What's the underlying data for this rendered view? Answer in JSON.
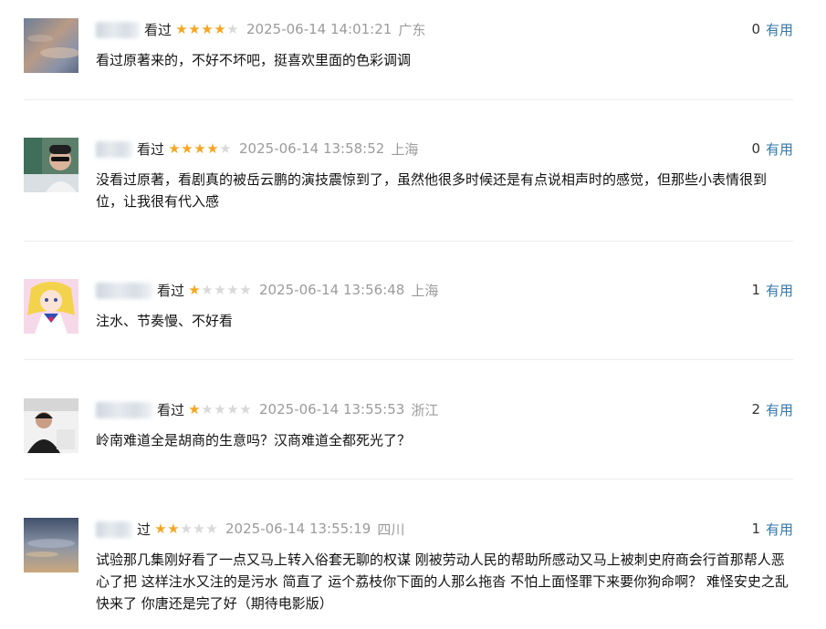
{
  "reviews": [
    {
      "action": "看过",
      "rating": 4,
      "time": "2025-06-14 14:01:21",
      "location": "广东",
      "votes": "0",
      "useful_label": "有用",
      "content": "看过原著来的，不好不坏吧，挺喜欢里面的色彩调调"
    },
    {
      "action": "看过",
      "rating": 4,
      "time": "2025-06-14 13:58:52",
      "location": "上海",
      "votes": "0",
      "useful_label": "有用",
      "content": "没看过原著，看剧真的被岳云鹏的演技震惊到了，虽然他很多时候还是有点说相声时的感觉，但那些小表情很到位，让我很有代入感"
    },
    {
      "action": "看过",
      "rating": 1,
      "time": "2025-06-14 13:56:48",
      "location": "上海",
      "votes": "1",
      "useful_label": "有用",
      "content": "注水、节奏慢、不好看"
    },
    {
      "action": "看过",
      "rating": 1,
      "time": "2025-06-14 13:55:53",
      "location": "浙江",
      "votes": "2",
      "useful_label": "有用",
      "content": "岭南难道全是胡商的生意吗？汉商难道全都死光了？"
    },
    {
      "action": "过",
      "rating": 2,
      "time": "2025-06-14 13:55:19",
      "location": "四川",
      "votes": "1",
      "useful_label": "有用",
      "content": "试验那几集刚好看了一点又马上转入俗套无聊的权谋 刚被劳动人民的帮助所感动又马上被刺史府商会行首那帮人恶心了把 这样注水又注的是污水 简直了 运个荔枝你下面的人那么拖沓 不怕上面怪罪下来要你狗命啊？ 难怪安史之乱快来了 你唐还是完了好（期待电影版）"
    }
  ],
  "colors": {
    "link": "#3377aa",
    "star_on": "#f5a623",
    "star_off": "#d9d9d9",
    "meta_gray": "#9b9b9b"
  }
}
